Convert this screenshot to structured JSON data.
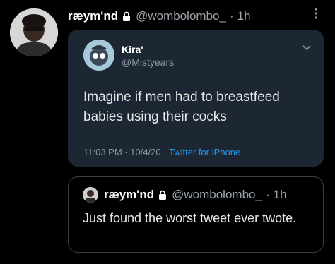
{
  "tweet": {
    "display_name": "ræym'nd",
    "handle": "@wombolombo_",
    "separator": "·",
    "time": "1h"
  },
  "quoted": {
    "display_name": "Kira'",
    "handle": "@Mistyears",
    "text": "Imagine if men had to breastfeed babies using their cocks",
    "time": "11:03 PM",
    "sep1": "·",
    "date": "10/4/20",
    "sep2": "·",
    "source": "Twitter for iPhone"
  },
  "reply": {
    "display_name": "ræym'nd",
    "handle": "@wombolombo_",
    "separator": "·",
    "time": "1h",
    "text": "Just found the worst tweet ever twote."
  },
  "icons": {
    "lock": "lock-icon",
    "more": "more-vertical-icon",
    "chevron": "chevron-down-icon"
  },
  "colors": {
    "background": "#000000",
    "card": "#1c2733",
    "link": "#1d9bf0",
    "muted": "#8b98a5"
  }
}
